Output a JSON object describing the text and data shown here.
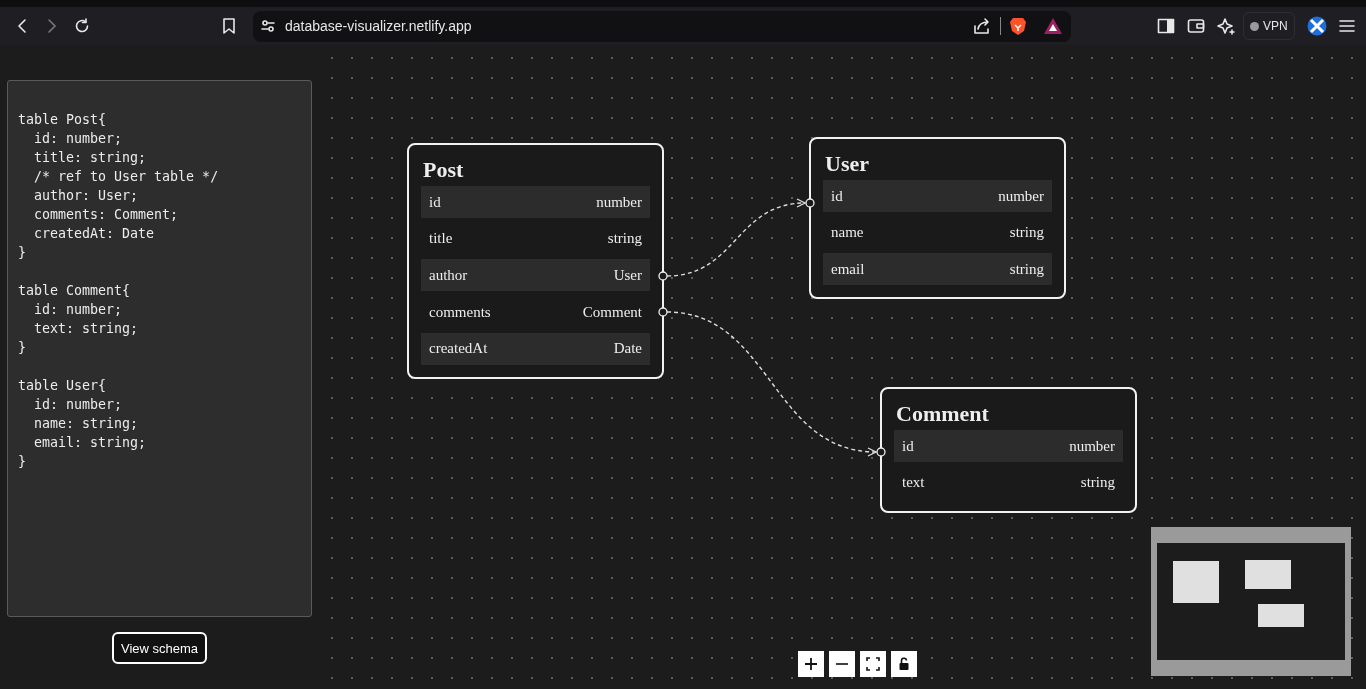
{
  "browser": {
    "url": "database-visualizer.netlify.app",
    "vpn_label": "VPN"
  },
  "editor": {
    "code": "table Post{\n  id: number;\n  title: string;\n  /* ref to User table */\n  author: User;\n  comments: Comment;\n  createdAt: Date\n}\n\ntable Comment{\n  id: number;\n  text: string;\n}\n\ntable User{\n  id: number;\n  name: string;\n  email: string;\n}"
  },
  "view_schema_button": {
    "label": "View schema"
  },
  "tables": [
    {
      "name": "Post",
      "fields": [
        {
          "name": "id",
          "type": "number"
        },
        {
          "name": "title",
          "type": "string"
        },
        {
          "name": "author",
          "type": "User"
        },
        {
          "name": "comments",
          "type": "Comment"
        },
        {
          "name": "createdAt",
          "type": "Date"
        }
      ]
    },
    {
      "name": "User",
      "fields": [
        {
          "name": "id",
          "type": "number"
        },
        {
          "name": "name",
          "type": "string"
        },
        {
          "name": "email",
          "type": "string"
        }
      ]
    },
    {
      "name": "Comment",
      "fields": [
        {
          "name": "id",
          "type": "number"
        },
        {
          "name": "text",
          "type": "string"
        }
      ]
    }
  ]
}
